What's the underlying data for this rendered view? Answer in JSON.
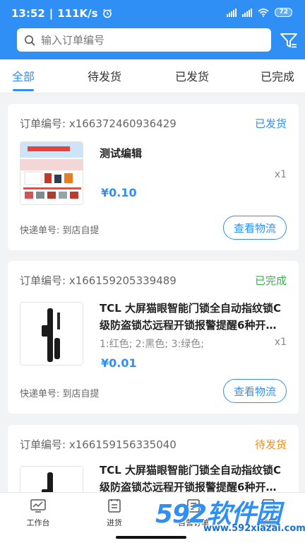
{
  "status_bar": {
    "time": "13:52",
    "speed": "111K/s",
    "battery": "72",
    "net1": "HD 4G",
    "net2": "HD 4G"
  },
  "search": {
    "placeholder": "输入订单编号"
  },
  "tabs": [
    {
      "label": "全部",
      "active": true
    },
    {
      "label": "待发货",
      "active": false
    },
    {
      "label": "已发货",
      "active": false
    },
    {
      "label": "已完成",
      "active": false
    }
  ],
  "orders": [
    {
      "order_no": "订单编号:  x166372460936429",
      "status": "已发货",
      "status_color": "#2f8ff5",
      "title": "测试编辑",
      "spec": "",
      "qty": "x1",
      "price": "¥0.10",
      "express": "快递单号:  到店自提",
      "button": "查看物流"
    },
    {
      "order_no": "订单编号:  x166159205339489",
      "status": "已完成",
      "status_color": "#35b34a",
      "title": "TCL 大屏猫眼智能门锁全自动指纹锁C级防盗锁芯远程开锁报警提醒6种开…",
      "spec": "1:红色; 2:黑色; 3:绿色;",
      "qty": "x1",
      "price": "¥0.01",
      "express": "快递单号:  到店自提",
      "button": "查看物流"
    },
    {
      "order_no": "订单编号:  x166159156335040",
      "status": "待发货",
      "status_color": "#f08c1e",
      "title": "TCL 大屏猫眼智能门锁全自动指纹锁C级防盗锁芯远程开锁报警提醒6种开…"
    }
  ],
  "bottom_nav": [
    {
      "label": "工作台",
      "icon": "chart-icon"
    },
    {
      "label": "进货",
      "icon": "clipboard-icon"
    },
    {
      "label": "自营订单",
      "icon": "order-icon"
    },
    {
      "label": "商铺",
      "icon": "shop-icon"
    }
  ],
  "watermark": {
    "logo": "592软件园",
    "url": "www.592xiazai.com"
  },
  "colors": {
    "primary": "#2f8ff5",
    "shipped": "#2f8ff5",
    "completed": "#35b34a",
    "pending": "#f08c1e"
  }
}
